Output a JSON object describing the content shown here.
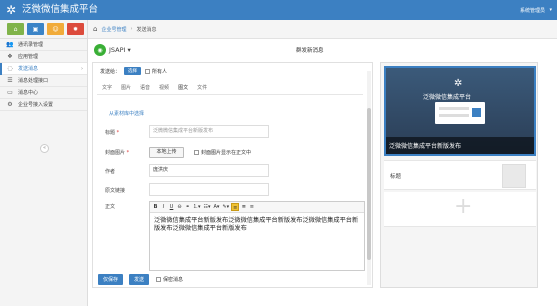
{
  "app": {
    "title": "泛微微信集成平台",
    "admin": "系统管理员"
  },
  "sidebar": {
    "items": [
      {
        "label": "通讯录管理",
        "icon": "users-icon"
      },
      {
        "label": "应用管理",
        "icon": "apps-icon"
      },
      {
        "label": "发送消息",
        "icon": "chat-icon"
      },
      {
        "label": "消息处理接口",
        "icon": "list-icon"
      },
      {
        "label": "消息中心",
        "icon": "message-icon"
      },
      {
        "label": "企业号接入设置",
        "icon": "gear-icon"
      }
    ]
  },
  "breadcrumb": {
    "parent": "企业号管理",
    "current": "发送消息"
  },
  "header": {
    "app_name": "JSAPI",
    "page_title": "群发新消息"
  },
  "form": {
    "target_label": "发送给：",
    "select_button": "选择",
    "all_label": "所有人",
    "tabs": [
      "文字",
      "图片",
      "语音",
      "视频",
      "图文",
      "文件"
    ],
    "active_tab": "图文",
    "from_library": "从素材库中选择",
    "title_label": "标题",
    "title_placeholder": "泛微微信集成平台新版发布",
    "cover_label": "封面图片",
    "upload_button": "本地上传",
    "show_cover_label": "封面图片显示在正文中",
    "author_label": "作者",
    "author_value": "庞洪庆",
    "link_label": "原文链接",
    "body_label": "正文",
    "body_text": "泛微微信集成平台新版发布泛微微信集成平台新版发布泛微微信集成平台新版发布泛微微信集成平台新版发布"
  },
  "footer": {
    "save_button": "仅保存",
    "send_button": "发送",
    "confidential_label": "保密消息"
  },
  "preview": {
    "logo_text": "泛微微信集成平台",
    "caption": "泛微微信集成平台新版发布",
    "item2_title": "标题"
  },
  "colors": {
    "primary": "#3c80c2",
    "wechat_green": "#3aaf36",
    "highlight": "#f1c232"
  }
}
